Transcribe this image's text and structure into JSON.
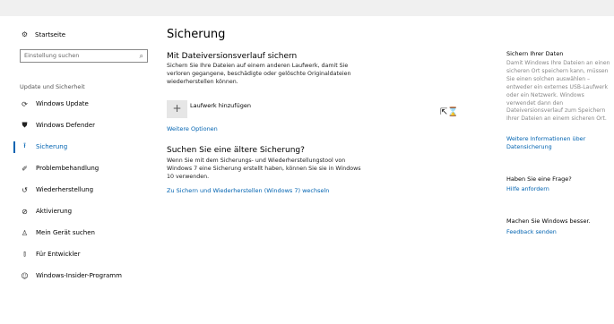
{
  "sidebar": {
    "home_label": "Startseite",
    "search_placeholder": "Einstellung suchen",
    "section_label": "Update und Sicherheit",
    "items": [
      {
        "label": "Windows Update",
        "icon": "sync-icon"
      },
      {
        "label": "Windows Defender",
        "icon": "shield-icon"
      },
      {
        "label": "Sicherung",
        "icon": "backup-arrow-icon",
        "active": true
      },
      {
        "label": "Problembehandlung",
        "icon": "wrench-icon"
      },
      {
        "label": "Wiederherstellung",
        "icon": "recovery-icon"
      },
      {
        "label": "Aktivierung",
        "icon": "check-circle-icon"
      },
      {
        "label": "Mein Gerät suchen",
        "icon": "person-location-icon"
      },
      {
        "label": "Für Entwickler",
        "icon": "developer-icon"
      },
      {
        "label": "Windows-Insider-Programm",
        "icon": "insider-icon"
      }
    ]
  },
  "main": {
    "title": "Sicherung",
    "history": {
      "heading": "Mit Dateiversionsverlauf sichern",
      "description": "Sichern Sie Ihre Dateien auf einem anderen Laufwerk, damit Sie verloren gegangene, beschädigte oder gelöschte Originaldateien wiederherstellen können.",
      "add_drive_label": "Laufwerk hinzufügen",
      "more_options_link": "Weitere Optionen"
    },
    "older": {
      "heading": "Suchen Sie eine ältere Sicherung?",
      "description": "Wenn Sie mit dem Sicherungs- und Wiederherstellungstool von Windows 7 eine Sicherung erstellt haben, können Sie sie in Windows 10 verwenden.",
      "link": "Zu Sichern und Wiederherstellen (Windows 7) wechseln"
    }
  },
  "right_panel": {
    "backup_heading": "Sichern Ihrer Daten",
    "backup_text": "Damit Windows Ihre Dateien an einen sicheren Ort speichern kann, müssen Sie einen solchen auswählen – entweder ein externes USB-Laufwerk oder ein Netzwerk. Windows verwendet dann den Dateiversionsverlauf zum Speichern Ihrer Dateien an einem sicheren Ort.",
    "backup_link": "Weitere Informationen über Datensicherung",
    "question_heading": "Haben Sie eine Frage?",
    "question_link": "Hilfe anfordern",
    "improve_heading": "Machen Sie Windows besser.",
    "feedback_link": "Feedback senden"
  },
  "colors": {
    "accent": "#0063b1",
    "muted_text": "#888888",
    "button_bg": "#e6e6e6"
  }
}
